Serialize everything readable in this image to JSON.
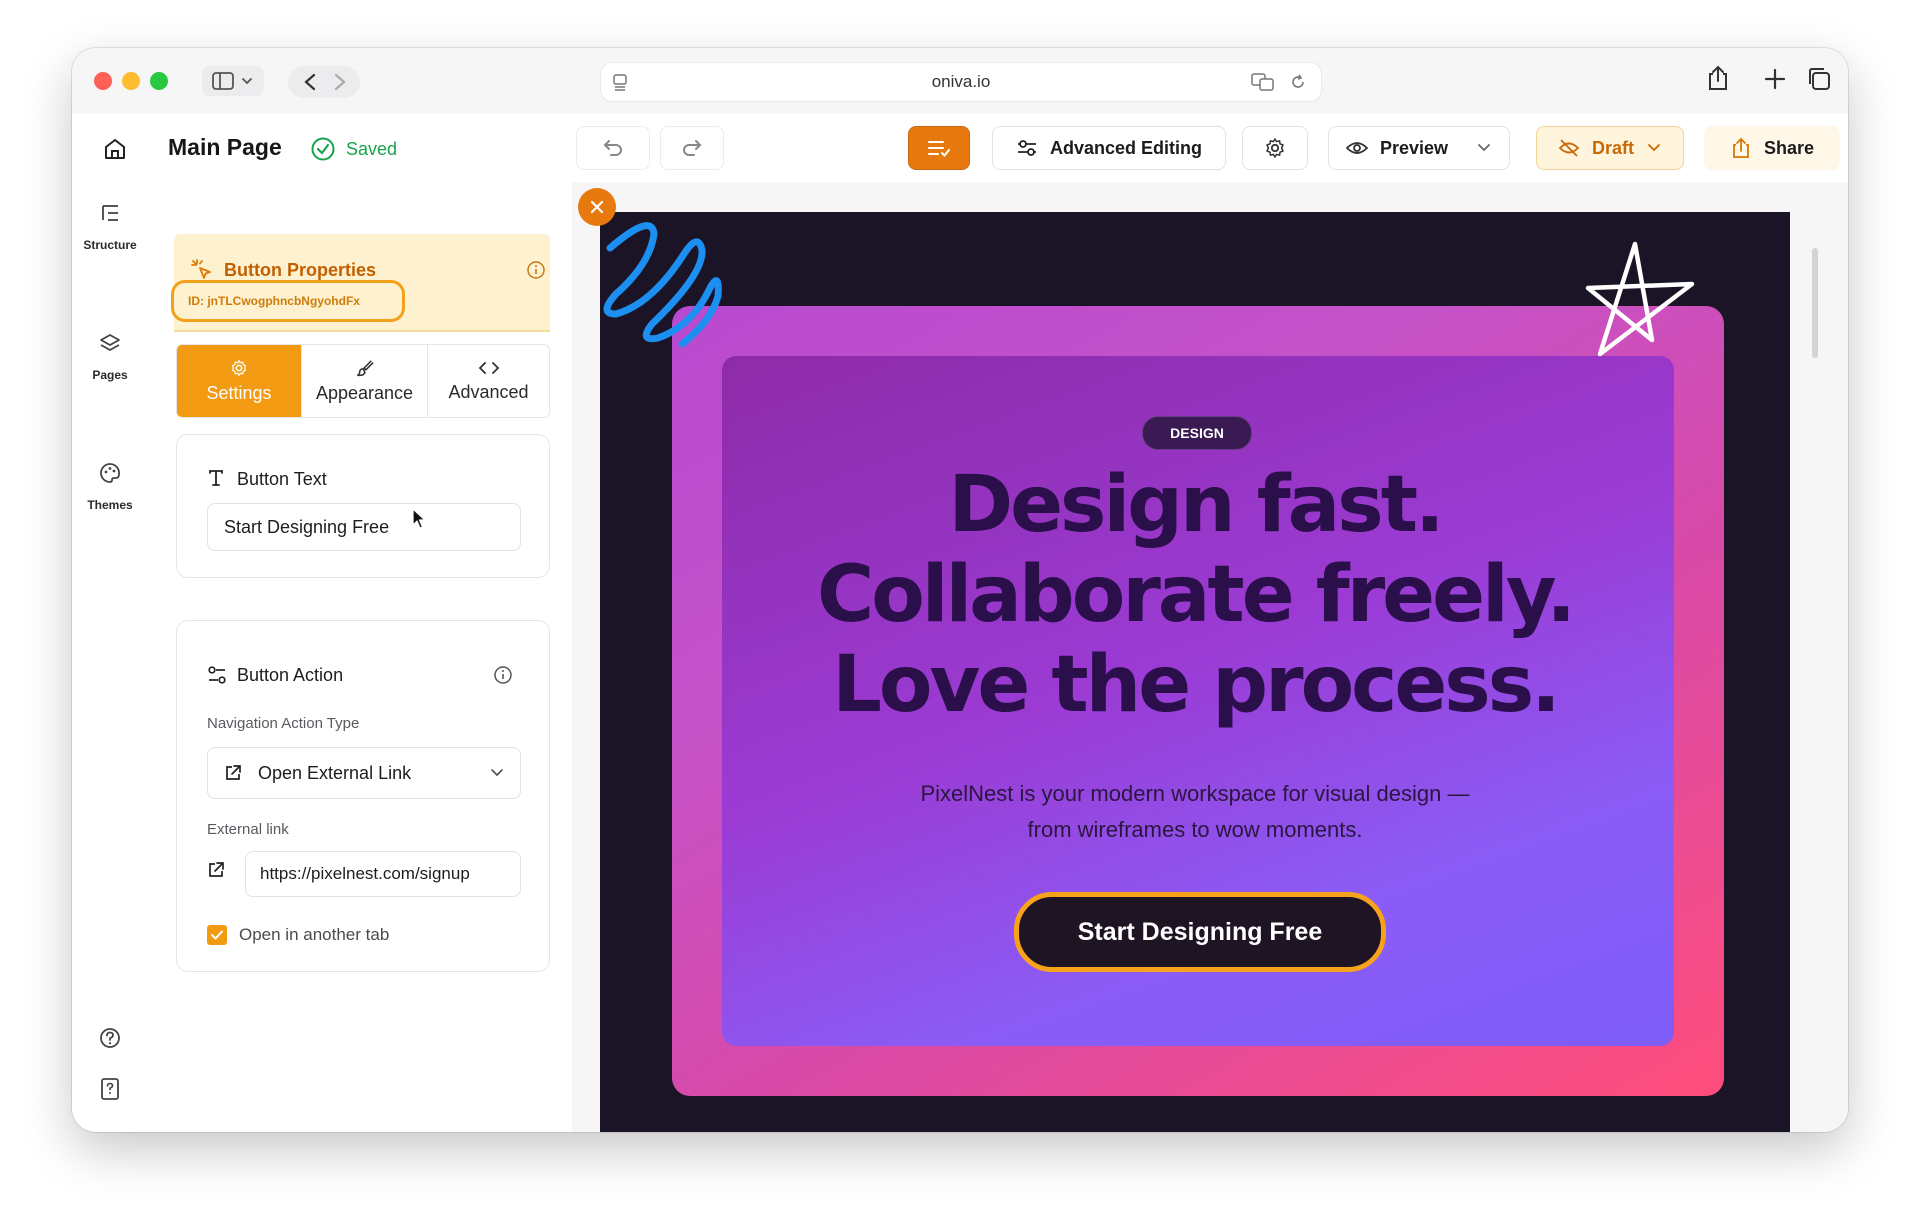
{
  "browser": {
    "url": "oniva.io"
  },
  "header": {
    "page_title": "Main Page",
    "saved_label": "Saved",
    "advanced_editing_label": "Advanced Editing",
    "preview_label": "Preview",
    "draft_label": "Draft",
    "share_label": "Share"
  },
  "rail": {
    "items": [
      {
        "label": "Structure",
        "icon": "structure-icon"
      },
      {
        "label": "Pages",
        "icon": "layers-icon"
      },
      {
        "label": "Themes",
        "icon": "palette-icon"
      }
    ],
    "footer_icons": [
      "help-circle-icon",
      "help-document-icon"
    ]
  },
  "panel": {
    "title": "Button Properties",
    "element_id": "ID: jnTLCwogphncbNgyohdFx",
    "tabs": [
      {
        "label": "Settings",
        "icon": "gear-icon",
        "active": true
      },
      {
        "label": "Appearance",
        "icon": "brush-icon",
        "active": false
      },
      {
        "label": "Advanced",
        "icon": "code-icon",
        "active": false
      }
    ],
    "button_text": {
      "label": "Button Text",
      "value": "Start Designing Free"
    },
    "button_action": {
      "label": "Button Action",
      "nav_type_label": "Navigation Action Type",
      "nav_type_value": "Open External Link",
      "external_link_label": "External link",
      "external_link_value": "https://pixelnest.com/signup",
      "open_new_tab_label": "Open in another tab",
      "open_new_tab_checked": true
    }
  },
  "hero": {
    "badge": "DESIGN",
    "headline_lines": [
      "Design fast.",
      "Collaborate freely.",
      "Love the process."
    ],
    "subtext_lines": [
      "PixelNest is your modern workspace for visual design —",
      "from wireframes to wow moments."
    ],
    "cta_label": "Start Designing Free"
  },
  "colors": {
    "accent_orange": "#f09a16",
    "saved_green": "#17a34a",
    "draft_bg": "#fff4dc",
    "hero_dark": "#1b1426",
    "scribble_blue": "#1d8ff0"
  }
}
